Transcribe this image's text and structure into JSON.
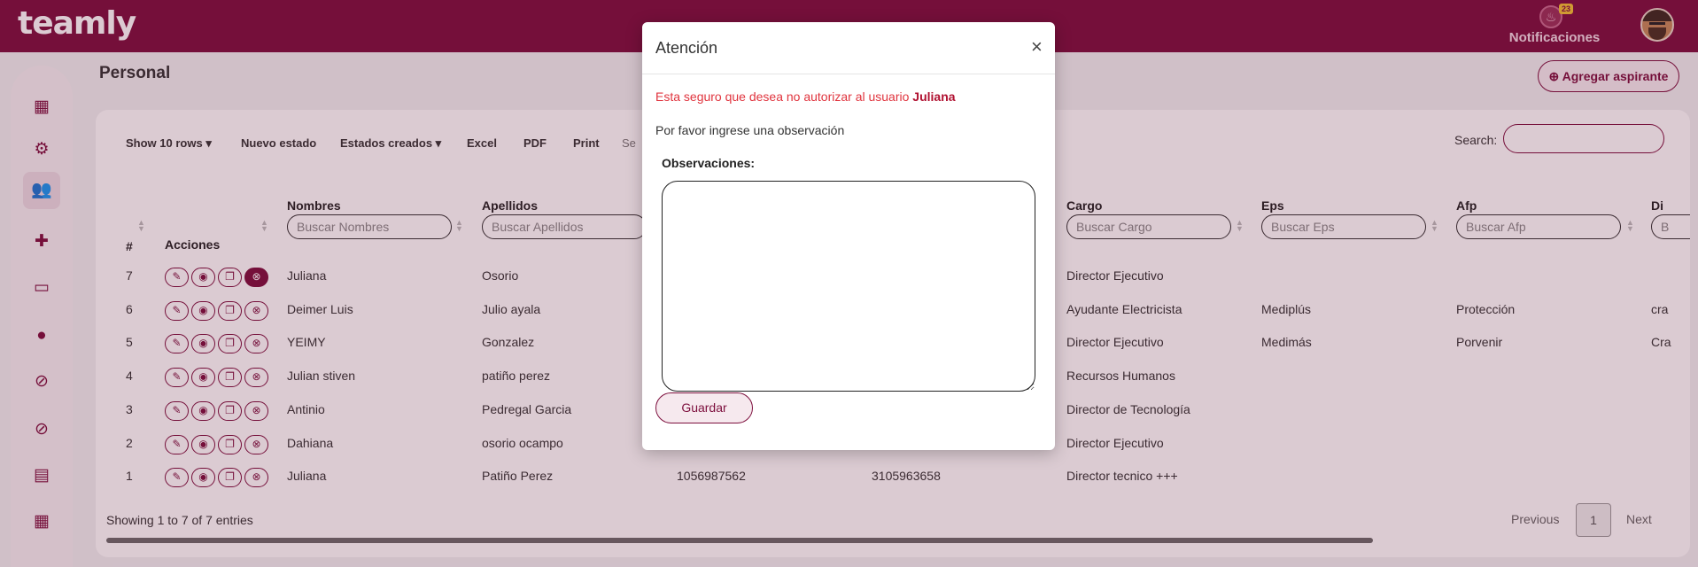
{
  "app": {
    "logo": "teamly"
  },
  "header": {
    "notifications_label": "Notificaciones",
    "notifications_count": "23"
  },
  "sidebar": {
    "items": [
      {
        "icon": "grid-icon",
        "glyph": "▦"
      },
      {
        "icon": "users-gear-icon",
        "glyph": "⚙"
      },
      {
        "icon": "users-icon",
        "glyph": "👥"
      },
      {
        "icon": "user-plus-icon",
        "glyph": "✚"
      },
      {
        "icon": "id-card-icon",
        "glyph": "▭"
      },
      {
        "icon": "user-tie-icon",
        "glyph": "●"
      },
      {
        "icon": "user-slash-icon",
        "glyph": "⊘"
      },
      {
        "icon": "user-slash-2-icon",
        "glyph": "⊘"
      },
      {
        "icon": "id-badge-icon",
        "glyph": "▤"
      },
      {
        "icon": "calendar-icon",
        "glyph": "▦"
      }
    ]
  },
  "page": {
    "title": "Personal",
    "add_button": "Agregar aspirante"
  },
  "toolbar": {
    "show_rows": "Show 10 rows",
    "new_state": "Nuevo estado",
    "created_states": "Estados creados",
    "excel": "Excel",
    "pdf": "PDF",
    "print": "Print",
    "search_label": "Search:",
    "hidden_button_fragment": "Se"
  },
  "table": {
    "headers": {
      "num": "#",
      "actions": "Acciones",
      "nombres": "Nombres",
      "apellidos": "Apellidos",
      "cargo": "Cargo",
      "eps": "Eps",
      "afp": "Afp",
      "dir": "Di"
    },
    "filters": {
      "nombres": "Buscar Nombres",
      "apellidos": "Buscar Apellidos",
      "cargo": "Buscar Cargo",
      "eps": "Buscar Eps",
      "afp": "Buscar Afp",
      "dir": "B"
    },
    "rows": [
      {
        "num": "7",
        "nombres": "Juliana",
        "apellidos": "Osorio",
        "doc": "",
        "tel": "",
        "cargo": "Director Ejecutivo",
        "eps": "",
        "afp": "",
        "dir": ""
      },
      {
        "num": "6",
        "nombres": "Deimer Luis",
        "apellidos": "Julio ayala",
        "doc": "",
        "tel": "",
        "cargo": "Ayudante Electricista",
        "eps": "Mediplús",
        "afp": "Protección",
        "dir": "cra"
      },
      {
        "num": "5",
        "nombres": "YEIMY",
        "apellidos": "Gonzalez",
        "doc": "",
        "tel": "",
        "cargo": "Director Ejecutivo",
        "eps": "Medimás",
        "afp": "Porvenir",
        "dir": "Cra"
      },
      {
        "num": "4",
        "nombres": "Julian stiven",
        "apellidos": "patiño perez",
        "doc": "",
        "tel": "",
        "cargo": "Recursos Humanos",
        "eps": "",
        "afp": "",
        "dir": ""
      },
      {
        "num": "3",
        "nombres": "Antinio",
        "apellidos": "Pedregal Garcia",
        "doc": "",
        "tel": "",
        "cargo": "Director de Tecnología",
        "eps": "",
        "afp": "",
        "dir": ""
      },
      {
        "num": "2",
        "nombres": "Dahiana",
        "apellidos": "osorio ocampo",
        "doc": "",
        "tel": "",
        "cargo": "Director Ejecutivo",
        "eps": "",
        "afp": "",
        "dir": ""
      },
      {
        "num": "1",
        "nombres": "Juliana",
        "apellidos": "Patiño Perez",
        "doc": "1056987562",
        "tel": "3105963658",
        "cargo": "Director tecnico +++",
        "eps": "",
        "afp": "",
        "dir": ""
      }
    ]
  },
  "footer": {
    "showing": "Showing 1 to 7 of 7 entries",
    "previous": "Previous",
    "page": "1",
    "next": "Next"
  },
  "modal": {
    "title": "Atención",
    "close": "×",
    "warning_prefix": "Esta seguro que desea no autorizar al usuario ",
    "warning_user": "Juliana",
    "prompt": "Por favor ingrese una observación",
    "obs_label": "Observaciones:",
    "obs_value": "",
    "save_button": "Guardar"
  },
  "colors": {
    "brand": "#7d0f3d",
    "warning": "#e0343e"
  }
}
